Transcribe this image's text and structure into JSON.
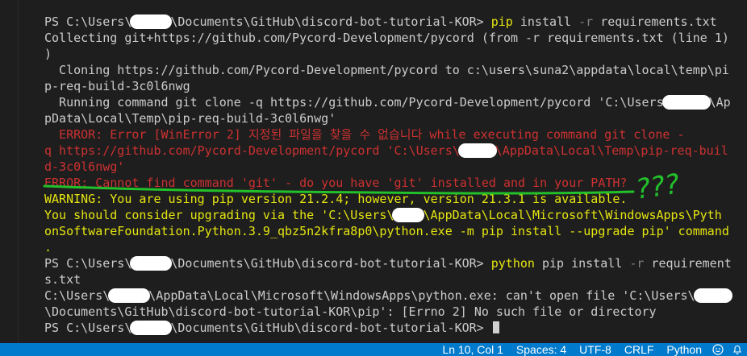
{
  "terminal": {
    "lines": [
      {
        "segs": [
          {
            "t": "PS C:\\Users\\",
            "c": "white"
          },
          {
            "redact": 52
          },
          {
            "t": "\\Documents\\GitHub\\discord-bot-tutorial-KOR> ",
            "c": "white"
          },
          {
            "t": "pip",
            "c": "cmd"
          },
          {
            "t": " install ",
            "c": "white"
          },
          {
            "t": "-r",
            "c": "opt"
          },
          {
            "t": " requirements.txt",
            "c": "white"
          }
        ]
      },
      {
        "segs": [
          {
            "t": "Collecting git+https://github.com/Pycord-Development/pycord (from -r requirements.txt (line 1)",
            "c": "white"
          }
        ]
      },
      {
        "segs": [
          {
            "t": ")",
            "c": "white"
          }
        ]
      },
      {
        "segs": [
          {
            "t": "  Cloning https://github.com/Pycord-Development/pycord to c:\\users\\suna2\\appdata\\local\\temp\\pi",
            "c": "white"
          }
        ]
      },
      {
        "segs": [
          {
            "t": "p-req-build-3c0l6nwg",
            "c": "white"
          }
        ]
      },
      {
        "segs": [
          {
            "t": "  Running command git clone -q https://github.com/Pycord-Development/pycord 'C:\\Users",
            "c": "white"
          },
          {
            "redact": 60
          },
          {
            "t": "\\Ap",
            "c": "white"
          }
        ]
      },
      {
        "segs": [
          {
            "t": "pData\\Local\\Temp\\pip-req-build-3c0l6nwg'",
            "c": "white"
          }
        ]
      },
      {
        "segs": [
          {
            "t": "  ERROR: Error [WinError 2] 지정된 파일을 찾을 수 없습니다 while executing command git clone -",
            "c": "err"
          }
        ]
      },
      {
        "segs": [
          {
            "t": "q https://github.com/Pycord-Development/pycord 'C:\\Users\\",
            "c": "err"
          },
          {
            "redact": 48
          },
          {
            "t": "\\AppData\\Local\\Temp\\pip-req-buil",
            "c": "err"
          }
        ]
      },
      {
        "segs": [
          {
            "t": "d-3c0l6nwg'",
            "c": "err"
          }
        ]
      },
      {
        "segs": [
          {
            "t": "ERROR: Cannot find command 'git' - do you have 'git' installed and in your PATH?",
            "c": "err"
          }
        ]
      },
      {
        "segs": [
          {
            "t": "WARNING: You are using pip version 21.2.4; however, version 21.3.1 is available.",
            "c": "warn"
          }
        ]
      },
      {
        "segs": [
          {
            "t": "You should consider upgrading via the 'C:\\Users\\",
            "c": "warn"
          },
          {
            "redact": 40
          },
          {
            "t": "\\AppData\\Local\\Microsoft\\WindowsApps\\Pyth",
            "c": "warn"
          }
        ]
      },
      {
        "segs": [
          {
            "t": "onSoftwareFoundation.Python.3.9_qbz5n2kfra8p0\\python.exe -m pip install --upgrade pip' command",
            "c": "warn"
          }
        ]
      },
      {
        "segs": [
          {
            "t": ".",
            "c": "warn"
          }
        ]
      },
      {
        "segs": [
          {
            "t": "PS C:\\Users\\",
            "c": "white"
          },
          {
            "redact": 52
          },
          {
            "t": "\\Documents\\GitHub\\discord-bot-tutorial-KOR> ",
            "c": "white"
          },
          {
            "t": "python",
            "c": "cmd"
          },
          {
            "t": " pip install ",
            "c": "white"
          },
          {
            "t": "-r",
            "c": "opt"
          },
          {
            "t": " requirement",
            "c": "white"
          }
        ]
      },
      {
        "segs": [
          {
            "t": "s.txt",
            "c": "white"
          }
        ]
      },
      {
        "segs": [
          {
            "t": "C:\\Users\\",
            "c": "white"
          },
          {
            "redact": 52
          },
          {
            "t": "\\AppData\\Local\\Microsoft\\WindowsApps\\python.exe: can't open file 'C:\\Users\\",
            "c": "white"
          },
          {
            "redact": 48
          }
        ]
      },
      {
        "segs": [
          {
            "t": "\\Documents\\GitHub\\discord-bot-tutorial-KOR\\pip': [Errno 2] No such file or directory",
            "c": "white"
          }
        ]
      },
      {
        "segs": [
          {
            "t": "PS C:\\Users\\",
            "c": "white"
          },
          {
            "redact": 52
          },
          {
            "t": "\\Documents\\GitHub\\discord-bot-tutorial-KOR> ",
            "c": "white"
          },
          {
            "cursor": true
          }
        ]
      }
    ]
  },
  "annotation": {
    "text": "???",
    "color": "#22c02a"
  },
  "statusbar": {
    "background": "#007acc",
    "position": "Ln 10, Col 1",
    "spaces": "Spaces: 4",
    "encoding": "UTF-8",
    "eol": "CRLF",
    "language": "Python",
    "icons": [
      "feedback-icon",
      "bell-icon"
    ]
  }
}
